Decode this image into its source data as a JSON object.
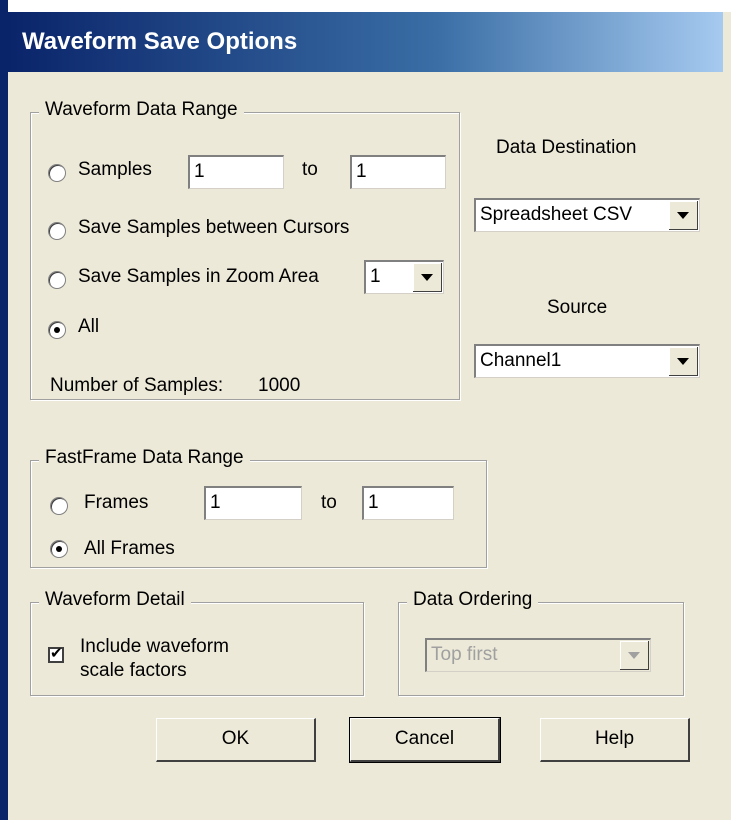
{
  "window": {
    "title": "Waveform Save Options"
  },
  "waveform_data_range": {
    "legend": "Waveform Data Range",
    "samples_label": "Samples",
    "samples_from": "1",
    "to_label": "to",
    "samples_to": "1",
    "between_cursors_label": "Save Samples between Cursors",
    "zoom_area_label": "Save Samples in Zoom Area",
    "zoom_area_value": "1",
    "all_label": "All",
    "num_samples_label": "Number of Samples:",
    "num_samples_value": "1000",
    "selected": "All"
  },
  "data_destination": {
    "label": "Data Destination",
    "value": "Spreadsheet CSV"
  },
  "source": {
    "label": "Source",
    "value": "Channel1"
  },
  "fastframe_data_range": {
    "legend": "FastFrame Data Range",
    "frames_label": "Frames",
    "frames_from": "1",
    "to_label": "to",
    "frames_to": "1",
    "all_frames_label": "All Frames",
    "selected": "All Frames"
  },
  "waveform_detail": {
    "legend": "Waveform Detail",
    "include_scale_line1": "Include waveform",
    "include_scale_line2": "scale factors",
    "checked": true
  },
  "data_ordering": {
    "legend": "Data Ordering",
    "value": "Top first",
    "enabled": false
  },
  "buttons": {
    "ok": "OK",
    "cancel": "Cancel",
    "help": "Help"
  }
}
